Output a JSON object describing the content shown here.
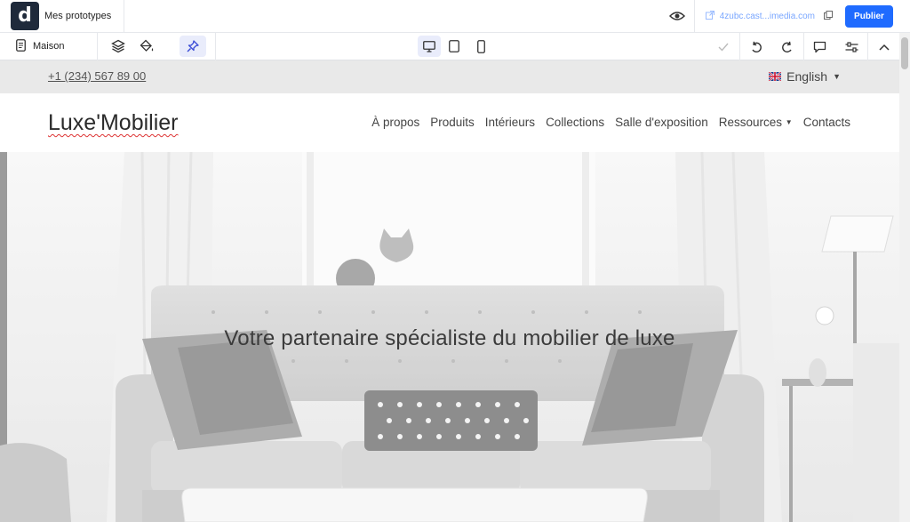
{
  "editor": {
    "project_title": "Mes prototypes",
    "url": "4zubc.cast...imedia.com",
    "publish_label": "Publier",
    "page_name": "Maison",
    "logo_letter": "d",
    "icons": {
      "logo": "logo-d-icon",
      "preview": "eye-icon",
      "external_link": "external-link-icon",
      "copy": "copy-icon",
      "page": "page-icon",
      "layers": "layers-icon",
      "fill": "paint-bucket-icon",
      "pin": "pin-icon",
      "desktop": "desktop-icon",
      "tablet": "tablet-icon",
      "mobile": "mobile-icon",
      "check": "check-icon",
      "undo": "undo-icon",
      "redo": "redo-icon",
      "comment": "comment-icon",
      "settings": "sliders-icon",
      "collapse": "chevron-up-icon"
    },
    "colors": {
      "accent": "#1f6bff",
      "active_bg": "#e9ecfb"
    }
  },
  "site": {
    "phone": "+1 (234) 567 89 00",
    "language": "English",
    "brand": "Luxe'Mobilier",
    "menu": [
      "À propos",
      "Produits",
      "Intérieurs",
      "Collections",
      "Salle d'exposition",
      "Ressources",
      "Contacts"
    ],
    "hero_headline": "Votre partenaire spécialiste du mobilier de luxe"
  }
}
